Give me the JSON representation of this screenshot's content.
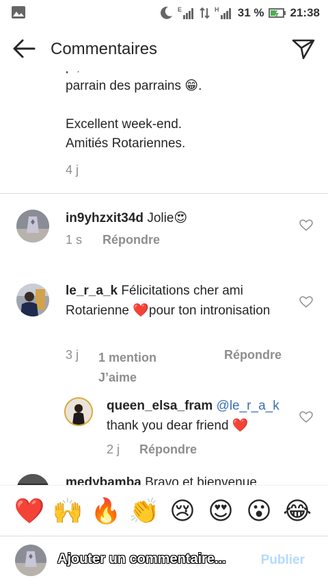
{
  "status_bar": {
    "battery": "31 %",
    "time": "21:38",
    "net_e": "E",
    "net_h": "H"
  },
  "header": {
    "title": "Commentaires",
    "back_icon": "arrow-left-icon",
    "send_icon": "paper-plane-icon"
  },
  "caption": {
    "line_cut": "p                                        ,",
    "line1": "parrain des parrains 😁.",
    "line2": "",
    "line3": "Excellent week-end.",
    "line4": "Amitiés Rotariennes.",
    "time": "4 j"
  },
  "comments": [
    {
      "user": "in9yhzxit34d",
      "text": "Jolie😍",
      "time": "1 s",
      "reply": "Répondre"
    },
    {
      "user": "le_r_a_k",
      "text": "Félicitations cher ami Rotarienne ❤️pour ton intronisation",
      "time": "3 j",
      "likes": "1 mention J’aime",
      "likes_line1": "1 mention",
      "likes_line2": "J’aime",
      "reply": "Répondre"
    },
    {
      "user": "queen_elsa_fram",
      "mention": "@le_r_a_k",
      "text": "thank you dear friend ❤️",
      "time": "2 j",
      "reply": "Répondre"
    },
    {
      "user": "medybamba",
      "text": "Bravo et bienvenue"
    }
  ],
  "emoji_bar": [
    "❤️",
    "🙌",
    "🔥",
    "👏",
    "😢",
    "😍",
    "😮",
    "😂"
  ],
  "input": {
    "placeholder": "Ajouter un commentaire...",
    "publish": "Publier"
  },
  "colors": {
    "link": "#3a6fb0",
    "muted": "#8e8e8e",
    "publish_disabled": "#b3dbff",
    "heart_red": "#e8222e"
  }
}
